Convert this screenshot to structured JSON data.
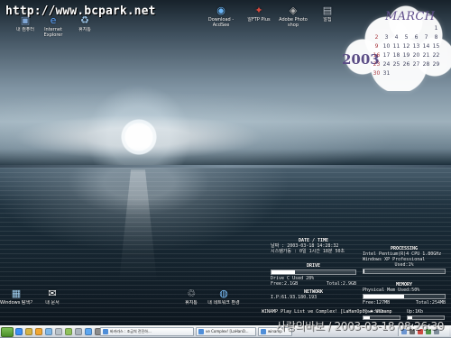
{
  "desktop": {
    "watermark": "http://www.bcpark.net",
    "top_icons": [
      {
        "label": "내 컴퓨터",
        "icon": "computer-icon",
        "color": "#7fa6d6"
      },
      {
        "label": "Internet\nExplorer",
        "icon": "internet-explorer-icon",
        "color": "#5ba3ff"
      },
      {
        "label": "휴지통",
        "icon": "recycle-bin-icon",
        "color": "#9ec8ec"
      },
      {
        "label": "Download -\nAcdSee",
        "icon": "download-icon",
        "color": "#6ab5f7"
      },
      {
        "label": "알FTP Plus",
        "icon": "ftp-icon",
        "color": "#d7493d"
      },
      {
        "label": "Adobe Photo\nshop",
        "icon": "photoshop-icon",
        "color": "#b4b4b4"
      },
      {
        "label": "알집",
        "icon": "archive-icon",
        "color": "#b9c2cb"
      }
    ],
    "calendar": {
      "month": "MARCH",
      "year": "2003",
      "rows": [
        [
          "",
          "",
          "",
          "",
          "",
          "",
          "1"
        ],
        [
          "2",
          "3",
          "4",
          "5",
          "6",
          "7",
          "8"
        ],
        [
          "9",
          "10",
          "11",
          "12",
          "13",
          "14",
          "15"
        ],
        [
          "16",
          "17",
          "18",
          "19",
          "20",
          "21",
          "22"
        ],
        [
          "23",
          "24",
          "25",
          "26",
          "27",
          "28",
          "29"
        ],
        [
          "30",
          "31",
          "",
          "",
          "",
          "",
          ""
        ]
      ]
    },
    "bottom_left_icons": [
      {
        "label": "Windows 탐색기",
        "icon": "windows-explorer-icon",
        "color": "#a2d2f4"
      },
      {
        "label": "내 문서",
        "icon": "my-documents-icon",
        "color": "#ffffff"
      }
    ],
    "middle_icons": [
      {
        "label": "휴지통",
        "icon": "recycle-bin-icon",
        "color": "#d6dde4"
      },
      {
        "label": "내 네트워크 환경",
        "icon": "network-icon",
        "color": "#7ec3ff"
      }
    ]
  },
  "sysinfo": {
    "date_time": {
      "title": "DATE / TIME",
      "line1": "날짜 : 2003-03-18  14:28:32",
      "line2": "시스템가동 : 0일 1시간 18분 50초"
    },
    "drive": {
      "title": "DRIVE",
      "used_text": "Drive C Used 28%",
      "usage": 0.28,
      "free_text": "Free:2.1GB",
      "total_text": "Total:2.9GB"
    },
    "network": {
      "title": "NETWORK",
      "ip": "I.P:61.93.180.193"
    },
    "processing": {
      "title": "PROCESSING",
      "cpu": "Intel Pentium(R)4 CPU 1.80GHz",
      "os": "Windows XP Professional",
      "used_text": "Used:1%",
      "usage": 0.01
    },
    "memory": {
      "title": "MEMORY",
      "used_text": "Physical Mem Used:50%",
      "usage": 0.5,
      "free_text": "Free:127MB",
      "total_text": "Total:254MB"
    },
    "meters": {
      "down": {
        "label": "Down:0Kb",
        "value": 0.18
      },
      "up": {
        "label": "Up:1Kb",
        "value": 0.12
      }
    }
  },
  "playlist": {
    "text": "WINAMP Play List  ve  Complex! [LaHanOpr]  ♣  Winamp"
  },
  "overlay": {
    "clock": "사랑의바보 / 2003-03-18 08:26:39"
  },
  "taskbar": {
    "quick_launch": [
      {
        "icon": "internet-icon",
        "color": "#3a8ef6"
      },
      {
        "icon": "folder-icon",
        "color": "#d5b245"
      },
      {
        "icon": "media-player-icon",
        "color": "#f0a633"
      },
      {
        "icon": "desktop-icon",
        "color": "#7cb6e8"
      },
      {
        "icon": "mail-icon",
        "color": "#b8c1c8"
      },
      {
        "icon": "messenger-icon",
        "color": "#8fc15c"
      },
      {
        "icon": "settings-icon",
        "color": "#aab3bc"
      },
      {
        "icon": "explorer-icon",
        "color": "#5ca6f0"
      },
      {
        "icon": "winamp-icon",
        "color": "#8b8b8b"
      },
      {
        "icon": "monitor-icon",
        "color": "#7fa9d6"
      }
    ],
    "tasks": [
      {
        "label": "바카라스 : 조금씩 전진하..."
      },
      {
        "label": "ve Complex! [LaHanO..."
      },
      {
        "label": "winamp"
      }
    ],
    "tray_icons": [
      {
        "icon": "network-tray-icon",
        "color": "#6b95d1"
      },
      {
        "icon": "volume-tray-icon",
        "color": "#6a6a6a"
      },
      {
        "icon": "security-tray-icon",
        "color": "#ce4a42"
      },
      {
        "icon": "update-tray-icon",
        "color": "#4e9348"
      },
      {
        "icon": "printer-tray-icon",
        "color": "#7e8c9a"
      }
    ]
  }
}
